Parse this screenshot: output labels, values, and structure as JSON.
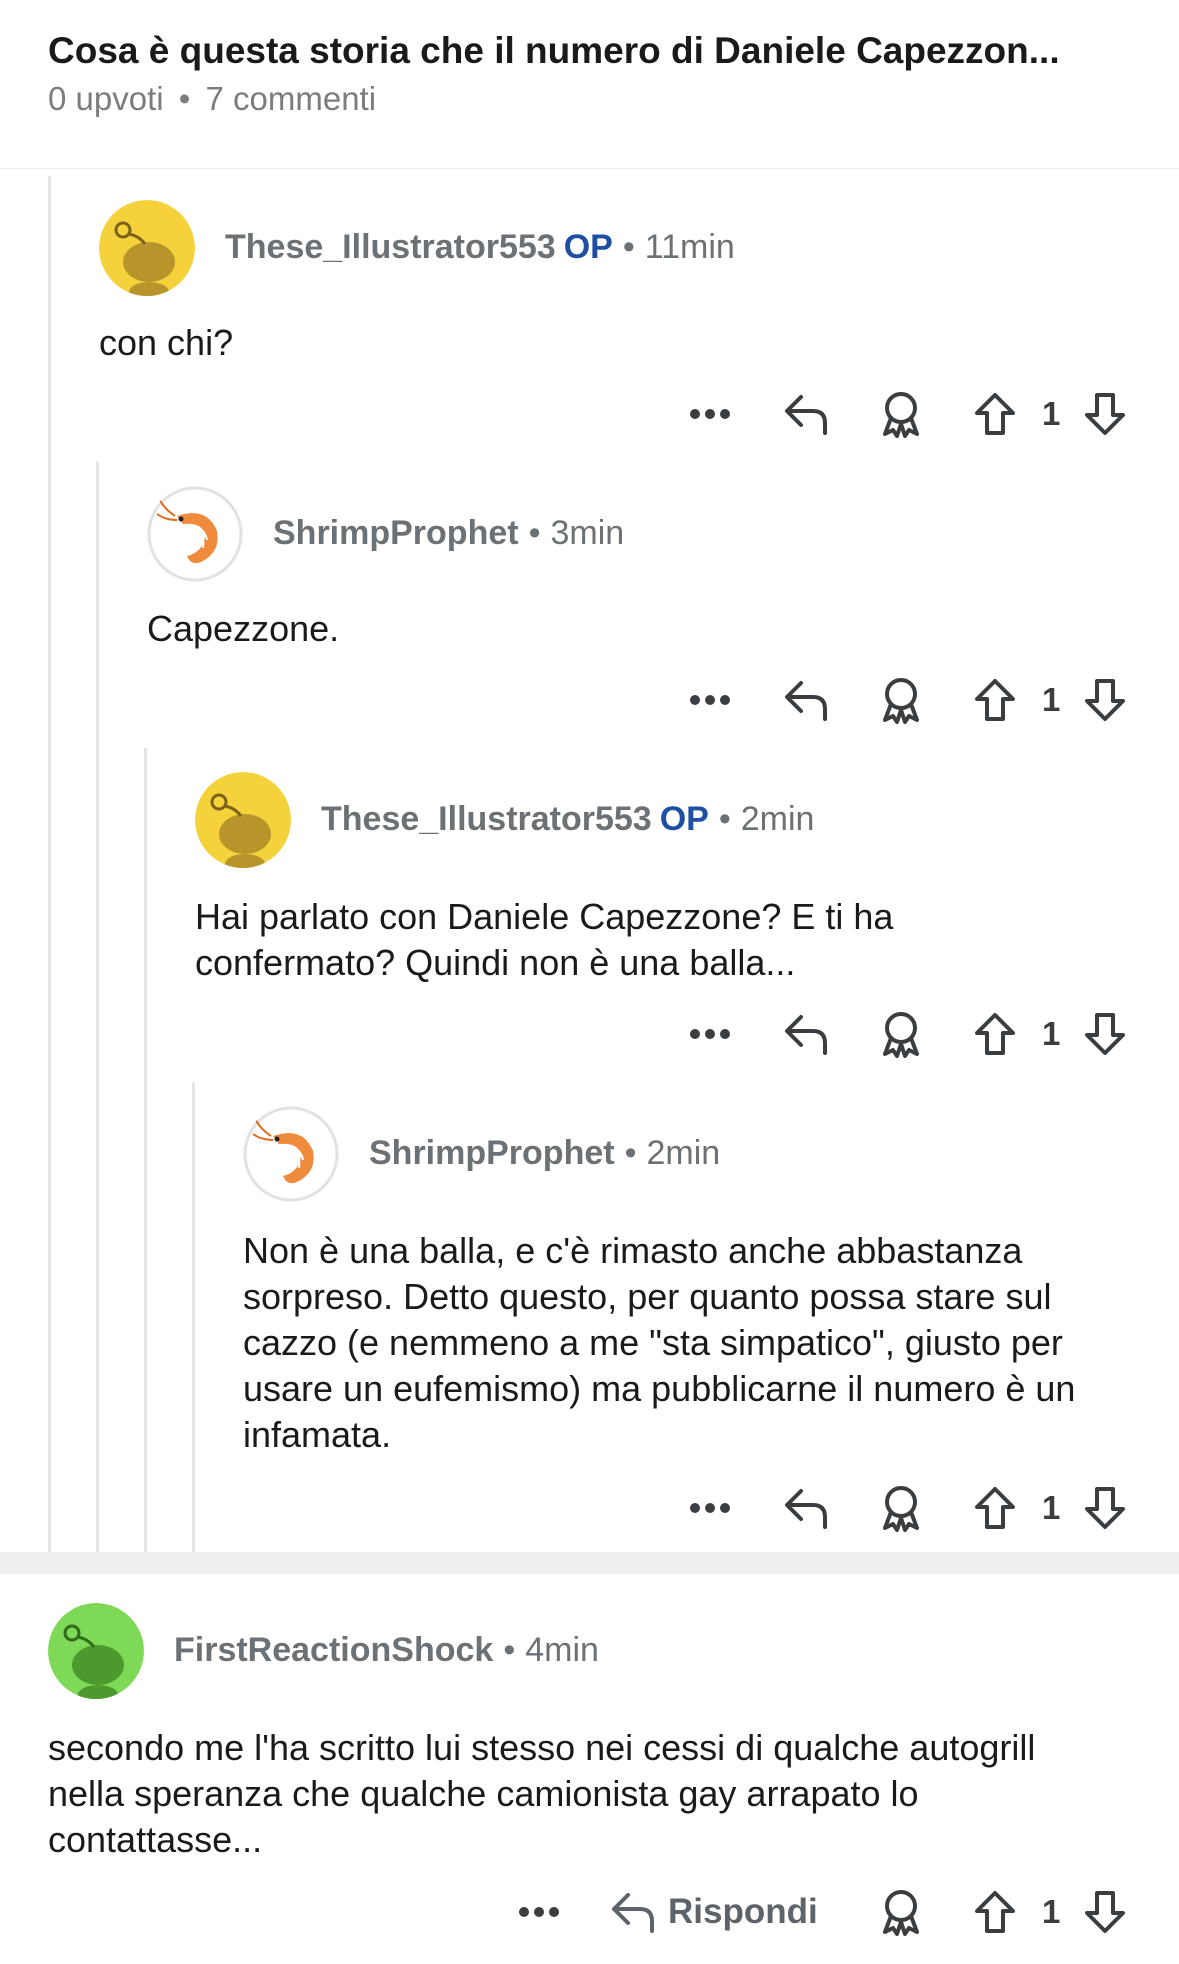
{
  "post": {
    "title": "Cosa è questa storia che il numero di Daniele Capezzon...",
    "upvotes": "0 upvoti",
    "separator": "•",
    "comments_count": "7 commenti"
  },
  "comments": [
    {
      "username": "These_Illustrator553",
      "op_label": "OP",
      "time": "11min",
      "body": "con chi?",
      "votes": "1",
      "avatar": "snoo-yellow"
    },
    {
      "username": "ShrimpProphet",
      "op_label": "",
      "time": "3min",
      "body": "Capezzone.",
      "votes": "1",
      "avatar": "shrimp"
    },
    {
      "username": "These_Illustrator553",
      "op_label": "OP",
      "time": "2min",
      "body": "Hai parlato con Daniele Capezzone? E ti ha confermato? Quindi non è una balla...",
      "votes": "1",
      "avatar": "snoo-yellow"
    },
    {
      "username": "ShrimpProphet",
      "op_label": "",
      "time": "2min",
      "body": "Non è una balla, e c'è rimasto anche abbastanza sorpreso. Detto questo, per quanto possa stare sul cazzo (e nemmeno a me \"sta simpatico\", giusto per usare un eufemismo) ma pubblicarne il numero è un infamata.",
      "votes": "1",
      "avatar": "shrimp"
    },
    {
      "username": "FirstReactionShock",
      "op_label": "",
      "time": "4min",
      "body": "secondo me l'ha scritto lui stesso nei cessi di qualche autogrill nella speranza che qualche camionista gay arrapato lo contattasse...",
      "votes": "1",
      "avatar": "snoo-green",
      "reply_label": "Rispondi"
    }
  ],
  "colors": {
    "op": "#1f4fa3",
    "avatar_yellow": "#f5d23c",
    "avatar_green": "#7ed957",
    "icon": "#5d6368"
  },
  "icons": [
    "more-icon",
    "reply-icon",
    "award-icon",
    "upvote-icon",
    "downvote-icon"
  ]
}
